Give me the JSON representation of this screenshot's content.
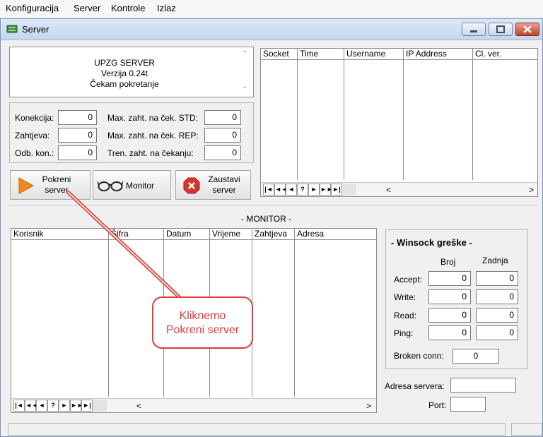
{
  "menu": [
    "Konfiguracija",
    "Server",
    "Kontrole",
    "Izlaz"
  ],
  "window": {
    "title": "Server"
  },
  "info": {
    "line1": "UPZG SERVER",
    "line2": "Verzija 0.24t",
    "line3": "Čekam pokretanje"
  },
  "counters": {
    "konekcija_label": "Konekcija:",
    "konekcija": "0",
    "zahtjeva_label": "Zahtjeva:",
    "zahtjeva": "0",
    "odb_label": "Odb. kon.:",
    "odb": "0",
    "std_label": "Max. zaht. na ček. STD:",
    "std": "0",
    "rep_label": "Max. zaht. na ček. REP:",
    "rep": "0",
    "tren_label": "Tren. zaht. na čekanju:",
    "tren": "0"
  },
  "buttons": {
    "start_line1": "Pokreni",
    "start_line2": "server",
    "monitor": "Monitor",
    "stop_line1": "Zaustavi",
    "stop_line2": "server"
  },
  "socket_table": {
    "columns": [
      "Socket",
      "Time",
      "Username",
      "IP Address",
      "Cl. ver."
    ]
  },
  "monitor": {
    "title": "- MONITOR -",
    "columns": [
      "Korisnik",
      "Šifra",
      "Datum",
      "Vrijeme",
      "Zahtjeva",
      "Adresa"
    ]
  },
  "nav_buttons": [
    "|◄",
    "◄◄",
    "◄",
    "?",
    "►",
    "►►",
    "►|"
  ],
  "scroll": {
    "left": "<",
    "right": ">"
  },
  "winsock": {
    "title": "- Winsock greške -",
    "col_broj": "Broj",
    "col_zadnja": "Zadnja",
    "rows": [
      {
        "label": "Accept:",
        "broj": "0",
        "zadnja": "0"
      },
      {
        "label": "Write:",
        "broj": "0",
        "zadnja": "0"
      },
      {
        "label": "Read:",
        "broj": "0",
        "zadnja": "0"
      },
      {
        "label": "Ping:",
        "broj": "0",
        "zadnja": "0"
      }
    ],
    "broken_label": "Broken conn:",
    "broken": "0"
  },
  "address": {
    "server_label": "Adresa servera:",
    "server": "",
    "port_label": "Port:",
    "port": ""
  },
  "callout": {
    "line1": "Kliknemo",
    "line2": "Pokreni server"
  },
  "colors": {
    "accent_red": "#e03a3a",
    "play_orange": "#f08a1c",
    "stop_red": "#d9362b"
  }
}
